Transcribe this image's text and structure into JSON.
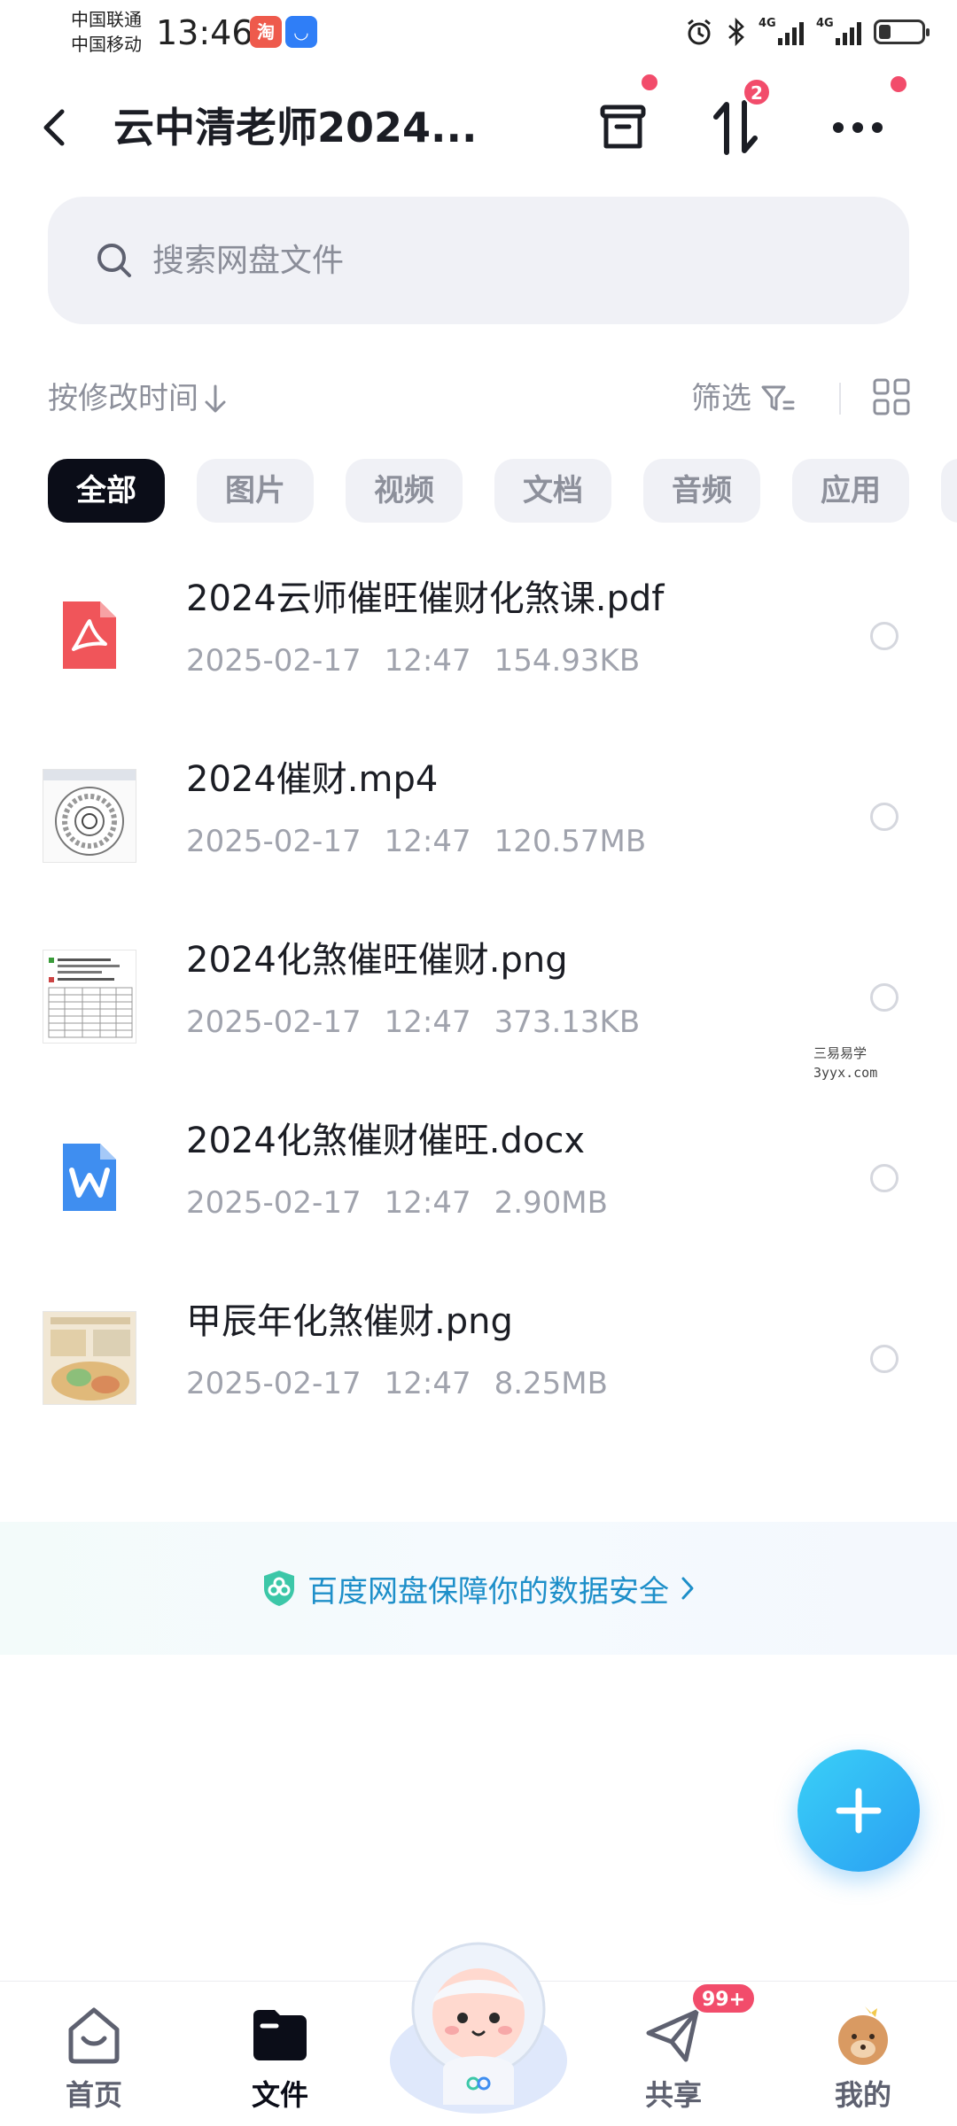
{
  "status_bar": {
    "carrier_1": "中国联通",
    "carrier_2": "中国移动",
    "time": "13:46",
    "network_1": "4G",
    "network_2": "4G",
    "icons": [
      "taobao-app-icon",
      "security-app-icon",
      "alarm-icon",
      "bluetooth-icon",
      "signal-icon",
      "signal-icon",
      "battery-icon"
    ]
  },
  "header": {
    "title": "云中清老师2024...",
    "transfer_badge": "2",
    "icons": [
      "back-arrow-icon",
      "recycle-bin-icon",
      "transfer-icon",
      "more-icon"
    ]
  },
  "search": {
    "placeholder": "搜索网盘文件"
  },
  "toolbar": {
    "sort_label": "按修改时间",
    "filter_label": "筛选"
  },
  "categories": [
    {
      "label": "全部",
      "active": true
    },
    {
      "label": "图片",
      "active": false
    },
    {
      "label": "视频",
      "active": false
    },
    {
      "label": "文档",
      "active": false
    },
    {
      "label": "音频",
      "active": false
    },
    {
      "label": "应用",
      "active": false
    }
  ],
  "files": [
    {
      "name": "2024云师催旺催财化煞课.pdf",
      "date": "2025-02-17",
      "time": "12:47",
      "size": "154.93KB",
      "icon": "pdf-file-icon"
    },
    {
      "name": "2024催财.mp4",
      "date": "2025-02-17",
      "time": "12:47",
      "size": "120.57MB",
      "icon": "video-thumbnail"
    },
    {
      "name": "2024化煞催旺催财.png",
      "date": "2025-02-17",
      "time": "12:47",
      "size": "373.13KB",
      "icon": "image-thumbnail"
    },
    {
      "name": "2024化煞催财催旺.docx",
      "date": "2025-02-17",
      "time": "12:47",
      "size": "2.90MB",
      "icon": "word-file-icon"
    },
    {
      "name": "甲辰年化煞催财.png",
      "date": "2025-02-17",
      "time": "12:47",
      "size": "8.25MB",
      "icon": "image-thumbnail"
    }
  ],
  "watermark": {
    "line1": "三易易学",
    "line2": "3yyx.com"
  },
  "safety_banner": {
    "text": "百度网盘保障你的数据安全"
  },
  "bottom_nav": {
    "home": "首页",
    "files": "文件",
    "share": "共享",
    "mine": "我的",
    "share_badge": "99+"
  },
  "colors": {
    "accent_blue": "#2a9ff2",
    "badge_red": "#f24c6b",
    "active_chip": "#0b0d18",
    "muted_text": "#a0a3ad"
  }
}
